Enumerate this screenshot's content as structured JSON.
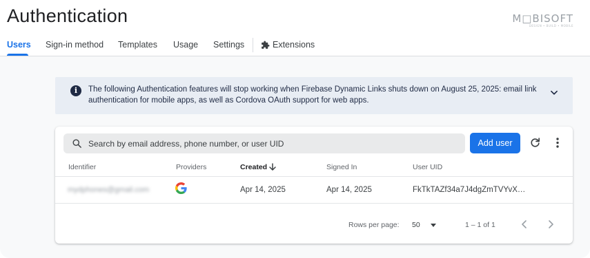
{
  "header": {
    "title": "Authentication",
    "logo_text": "M□BISOFT",
    "logo_tagline": "DESIGN • BUILD • MOBILE"
  },
  "tabs": [
    {
      "label": "Users",
      "active": true
    },
    {
      "label": "Sign-in method",
      "active": false
    },
    {
      "label": "Templates",
      "active": false
    },
    {
      "label": "Usage",
      "active": false
    },
    {
      "label": "Settings",
      "active": false
    },
    {
      "label": "Extensions",
      "active": false,
      "icon": "extension-puzzle-icon"
    }
  ],
  "banner": {
    "icon": "info-icon",
    "message": "The following Authentication features will stop working when Firebase Dynamic Links shuts down on August 25, 2025: email link authentication for mobile apps, as well as Cordova OAuth support for web apps.",
    "expand_icon": "chevron-down-icon"
  },
  "toolbar": {
    "search_placeholder": "Search by email address, phone number, or user UID",
    "add_user_label": "Add user"
  },
  "table": {
    "columns": [
      "Identifier",
      "Providers",
      "Created",
      "Signed In",
      "User UID"
    ],
    "sorted_column": "Created",
    "rows": [
      {
        "identifier": "mydphones@gmail.com",
        "provider": "google-icon",
        "created": "Apr 14, 2025",
        "signed_in": "Apr 14, 2025",
        "uid": "FkTkTAZf34a7J4dgZmTVYvX…"
      }
    ]
  },
  "pagination": {
    "rows_per_page_label": "Rows per page:",
    "rows_per_page": "50",
    "range": "1 – 1 of 1"
  },
  "colors": {
    "accent": "#1a73e8",
    "banner_bg": "#e8edf4",
    "banner_text": "#1f2a44"
  }
}
